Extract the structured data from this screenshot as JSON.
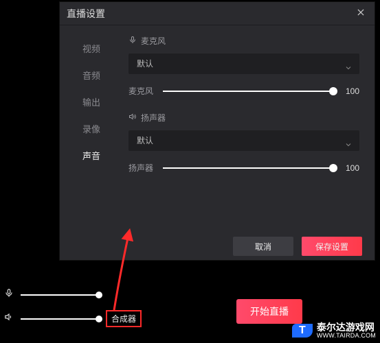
{
  "dialog": {
    "title": "直播设置",
    "side": {
      "items": [
        {
          "label": "视频"
        },
        {
          "label": "音频"
        },
        {
          "label": "输出"
        },
        {
          "label": "录像"
        },
        {
          "label": "声音"
        }
      ],
      "active_index": 4
    },
    "mic": {
      "section_label": "麦克风",
      "dropdown_value": "默认",
      "slider_label": "麦克风",
      "slider_value": 100
    },
    "speaker": {
      "section_label": "扬声器",
      "dropdown_value": "默认",
      "slider_label": "扬声器",
      "slider_value": 100
    },
    "buttons": {
      "cancel": "取消",
      "save": "保存设置"
    }
  },
  "bottom_bar": {
    "mic_volume": 100,
    "speaker_volume": 100,
    "mixer_label": "合成器"
  },
  "start_live_button": "开始直播",
  "watermark": {
    "badge": "T",
    "name": "泰尔达游戏网",
    "url": "WWW.TAIRDA.COM"
  }
}
